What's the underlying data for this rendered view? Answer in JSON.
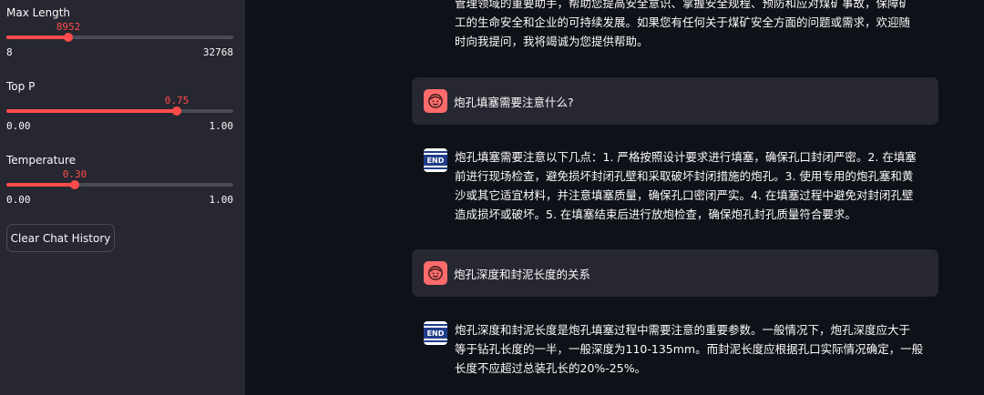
{
  "sidebar": {
    "max_length": {
      "label": "Max Length",
      "value": "8952",
      "min": "8",
      "max": "32768",
      "fraction": 0.273
    },
    "top_p": {
      "label": "Top P",
      "value": "0.75",
      "min": "0.00",
      "max": "1.00",
      "fraction": 0.75
    },
    "temperature": {
      "label": "Temperature",
      "value": "0.30",
      "min": "0.00",
      "max": "1.00",
      "fraction": 0.3
    },
    "clear_button": "Clear Chat History"
  },
  "chat": {
    "partial_top": [
      "管理领域的重要助手，帮助您提高安全意识、掌握安全规程、预防和应对煤矿事故，保障矿",
      "工的生命安全和企业的可持续发展。如果您有任何关于煤矿安全方面的问题或需求，欢迎随",
      "时向我提问，我将竭诚为您提供帮助。"
    ],
    "user_1": "炮孔填塞需要注意什么?",
    "bot_1": [
      "炮孔填塞需要注意以下几点：1. 严格按照设计要求进行填塞，确保孔口封闭严密。2. 在填塞",
      "前进行现场检查，避免损坏封闭孔壁和采取破坏封闭措施的炮孔。3. 使用专用的炮孔塞和黄",
      "沙或其它适宜材料，并注意填塞质量，确保孔口密闭严实。4. 在填塞过程中避免对封闭孔壁",
      "造成损坏或破坏。5. 在填塞结束后进行放炮检查，确保炮孔封孔质量符合要求。"
    ],
    "user_2": "炮孔深度和封泥长度的关系",
    "bot_2": [
      "炮孔深度和封泥长度是炮孔填塞过程中需要注意的重要参数。一般情况下，炮孔深度应大于",
      "等于钻孔长度的一半，一般深度为110-135mm。而封泥长度应根据孔口实际情况确定，一般",
      "长度不应超过总装孔长的20%-25%。"
    ],
    "bot_avatar_text": "END"
  },
  "icons": {
    "user_avatar": "smiley-face-icon",
    "bot_avatar": "end-logo-icon"
  },
  "colors": {
    "accent": "#ff4b4b",
    "sidebar_bg": "#262730",
    "main_bg": "#0e1117",
    "user_avatar_bg": "#ff6b6b",
    "bot_logo": "#1f3d8a"
  }
}
